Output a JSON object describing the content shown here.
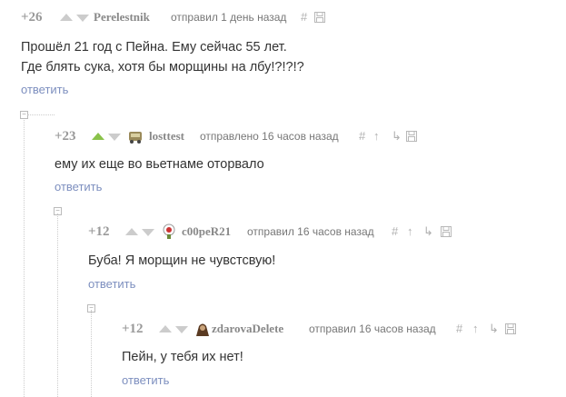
{
  "comments": [
    {
      "rating": "+26",
      "author": "Perelestnik",
      "time": "отправил 1 день назад",
      "lines": [
        "Прошёл 21 год с Пейна. Ему сейчас 55 лет.",
        "Где блять сука, хотя бы морщины на лбу!?!?!?"
      ],
      "reply": "ответить",
      "upvoted": false
    },
    {
      "rating": "+23",
      "author": "losttest",
      "time": "отправлено 16 часов назад",
      "lines": [
        "ему их еще во вьетнаме оторвало"
      ],
      "reply": "ответить",
      "upvoted": true
    },
    {
      "rating": "+12",
      "author": "c00peR21",
      "time": "отправил 16 часов назад",
      "lines": [
        "Буба! Я морщин не чувстсвую!"
      ],
      "reply": "ответить",
      "upvoted": false
    },
    {
      "rating": "+12",
      "author": "zdarovaDelete",
      "time": "отправил 16 часов назад",
      "lines": [
        "Пейн, у тебя их нет!"
      ],
      "reply": "ответить",
      "upvoted": false
    }
  ],
  "icons": {
    "hash": "hash-icon",
    "save": "save-icon",
    "parent": "parent-link-icon",
    "branch": "branch-icon",
    "collapse": "collapse-icon"
  }
}
